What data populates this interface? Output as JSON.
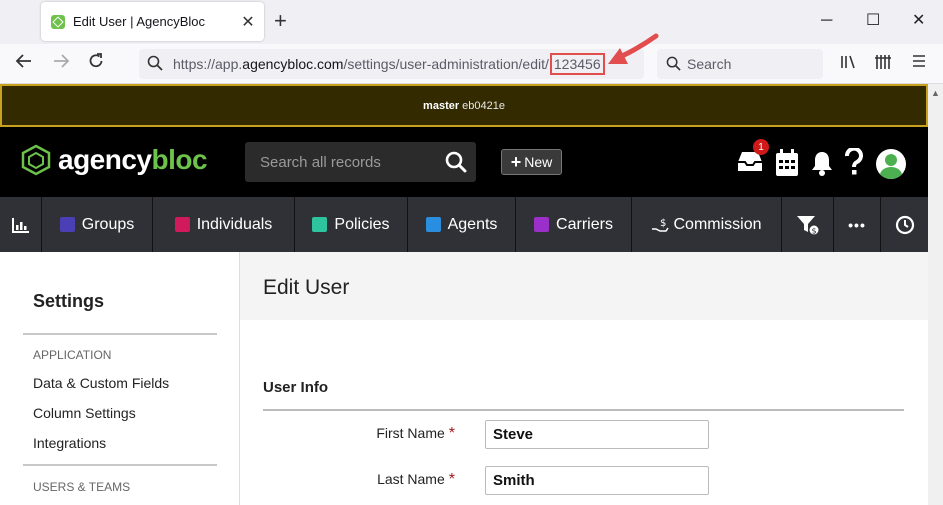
{
  "browser": {
    "tab_title": "Edit User | AgencyBloc",
    "tab_close": "✕",
    "new_tab": "+",
    "window_controls": {
      "minimize": "─",
      "maximize": "☐",
      "close": "✕"
    },
    "url_prefix": "https://app.",
    "url_host": "agencybloc.com",
    "url_path": "/settings/user-administration/edit/",
    "url_id": "123456",
    "search_placeholder": "Search",
    "accent": "#e24e4e"
  },
  "banner": {
    "branch": "master",
    "hash": "eb0421e",
    "border_color": "#c8a21c"
  },
  "header": {
    "logo_part1": "agency",
    "logo_part2": "bloc",
    "search_placeholder": "Search all records",
    "new_button_plus": "+",
    "new_button_label": "New",
    "notifications_count": "1"
  },
  "modules": [
    {
      "label": "",
      "icon": "chart-icon"
    },
    {
      "label": "Groups",
      "color": "#4a3fb5"
    },
    {
      "label": "Individuals",
      "color": "#d11a5a"
    },
    {
      "label": "Policies",
      "color": "#2ec4a0"
    },
    {
      "label": "Agents",
      "color": "#2a8ee0"
    },
    {
      "label": "Carriers",
      "color": "#9b2fc9"
    },
    {
      "label": "Commission",
      "icon": "hand-dollar-icon"
    },
    {
      "label": "",
      "icon": "filter-dollar-icon"
    },
    {
      "label": "•••",
      "icon": "more-icon"
    },
    {
      "label": "",
      "icon": "clock-icon"
    }
  ],
  "sidebar": {
    "title": "Settings",
    "section_application": "APPLICATION",
    "items": [
      "Data & Custom Fields",
      "Column Settings",
      "Integrations"
    ],
    "section_users": "USERS & TEAMS"
  },
  "main": {
    "title": "Edit User",
    "section": "User Info",
    "required_mark": "*",
    "fields": [
      {
        "label": "First Name",
        "value": "Steve"
      },
      {
        "label": "Last Name",
        "value": "Smith"
      }
    ]
  }
}
